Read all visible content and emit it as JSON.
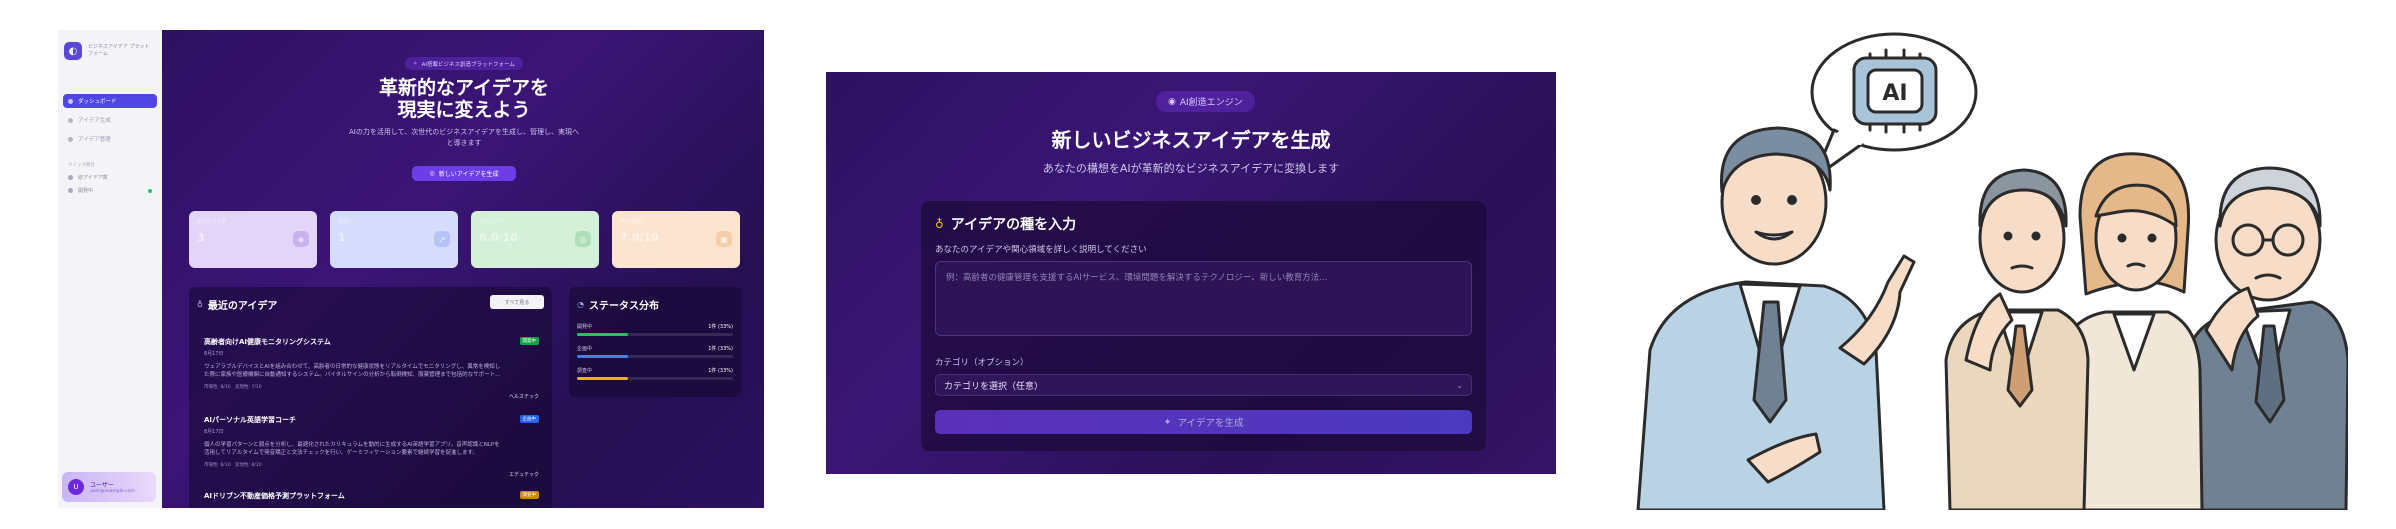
{
  "dashboard": {
    "sidebar": {
      "brand": [
        "ビジネスアイデア プラット",
        "フォーム"
      ],
      "nav": [
        {
          "label": "ダッシュボード",
          "active": true
        },
        {
          "label": "アイデア生成",
          "active": false
        },
        {
          "label": "アイデア管理",
          "active": false
        }
      ],
      "section_label": "クイック統計",
      "quick": [
        {
          "label": "総アイデア数"
        },
        {
          "label": "開発中"
        }
      ],
      "user": {
        "initial": "U",
        "name": "ユーザー",
        "email": "user@example.com"
      }
    },
    "hero": {
      "pill": "AI搭載ビジネス創造プラットフォーム",
      "title_line1": "革新的なアイデアを",
      "title_line2": "現実に変えよう",
      "subtitle_line1": "AIの力を活用して、次世代のビジネスアイデアを生成し、管理し、実現へ",
      "subtitle_line2": "と導きます",
      "button": "新しいアイデアを生成"
    },
    "stats": [
      {
        "label": "総アイデア数",
        "value": "3",
        "bg": "#e3d5f7",
        "icon_bg": "#c9b3ee",
        "icon": "◈"
      },
      {
        "label": "開発中",
        "value": "1",
        "bg": "#d6dcfb",
        "icon_bg": "#b6c3f6",
        "icon": "↗"
      },
      {
        "label": "平均スコア",
        "value": "8.0/10",
        "bg": "#d5f0d9",
        "icon_bg": "#aee0b8",
        "icon": "◎"
      },
      {
        "label": "平均実現性",
        "value": "7.0/10",
        "bg": "#fbe5d0",
        "icon_bg": "#f5cfa8",
        "icon": "▣"
      }
    ],
    "recent": {
      "title": "最近のアイデア",
      "view_all": "すべて見る",
      "items": [
        {
          "title": "高齢者向けAI健康モニタリングシステム",
          "date": "8月17日",
          "desc_line1": "ウェアラブルデバイスとAIを組み合わせて、高齢者の日常的な健康状態をリアルタイムでモニタリングし、異常を検知し",
          "desc_line2": "た際に家族や医療機関に自動通知するシステム。バイタルサインの分析から転倒検知、服薬管理まで包括的なサポート...",
          "meta": "市場性: 8/10　実現性: 7/10",
          "category": "ヘルステック",
          "status": "開発中",
          "status_color": "#16a34a"
        },
        {
          "title": "AIパーソナル英語学習コーチ",
          "date": "8月17日",
          "desc_line1": "個人の学習パターンと弱点を分析し、最適化されたカリキュラムを動的に生成するAI英語学習アプリ。音声認識とNLPを",
          "desc_line2": "活用してリアルタイムで発音矯正と文法チェックを行い、ゲーミフィケーション要素で継続学習を促進します。",
          "meta": "市場性: 8/10　実現性: 8/10",
          "category": "エデュテック",
          "status": "企画中",
          "status_color": "#2563eb"
        },
        {
          "title": "AIドリブン不動産価格予測プラットフォーム",
          "status": "調査中",
          "status_color": "#ca8a04"
        }
      ]
    },
    "status_dist": {
      "title": "ステータス分布",
      "rows": [
        {
          "label": "開発中",
          "value": "1件 (33%)",
          "pct": 33,
          "color": "#22c55e"
        },
        {
          "label": "企画中",
          "value": "1件 (33%)",
          "pct": 33,
          "color": "#3b82f6"
        },
        {
          "label": "調査中",
          "value": "1件 (33%)",
          "pct": 33,
          "color": "#eab308"
        }
      ]
    }
  },
  "generator": {
    "pill": "AI創造エンジン",
    "title": "新しいビジネスアイデアを生成",
    "subtitle": "あなたの構想をAIが革新的なビジネスアイデアに変換します",
    "card_title": "アイデアの種を入力",
    "input_label": "あなたのアイデアや関心領域を詳しく説明してください",
    "input_placeholder": "例：高齢者の健康管理を支援するAIサービス、環境問題を解決するテクノロジー、新しい教育方法...",
    "category_label": "カテゴリ（オプション）",
    "category_selected": "カテゴリを選択（任意）",
    "submit": "アイデアを生成"
  },
  "illustration": {
    "bubble_text": "AI"
  }
}
